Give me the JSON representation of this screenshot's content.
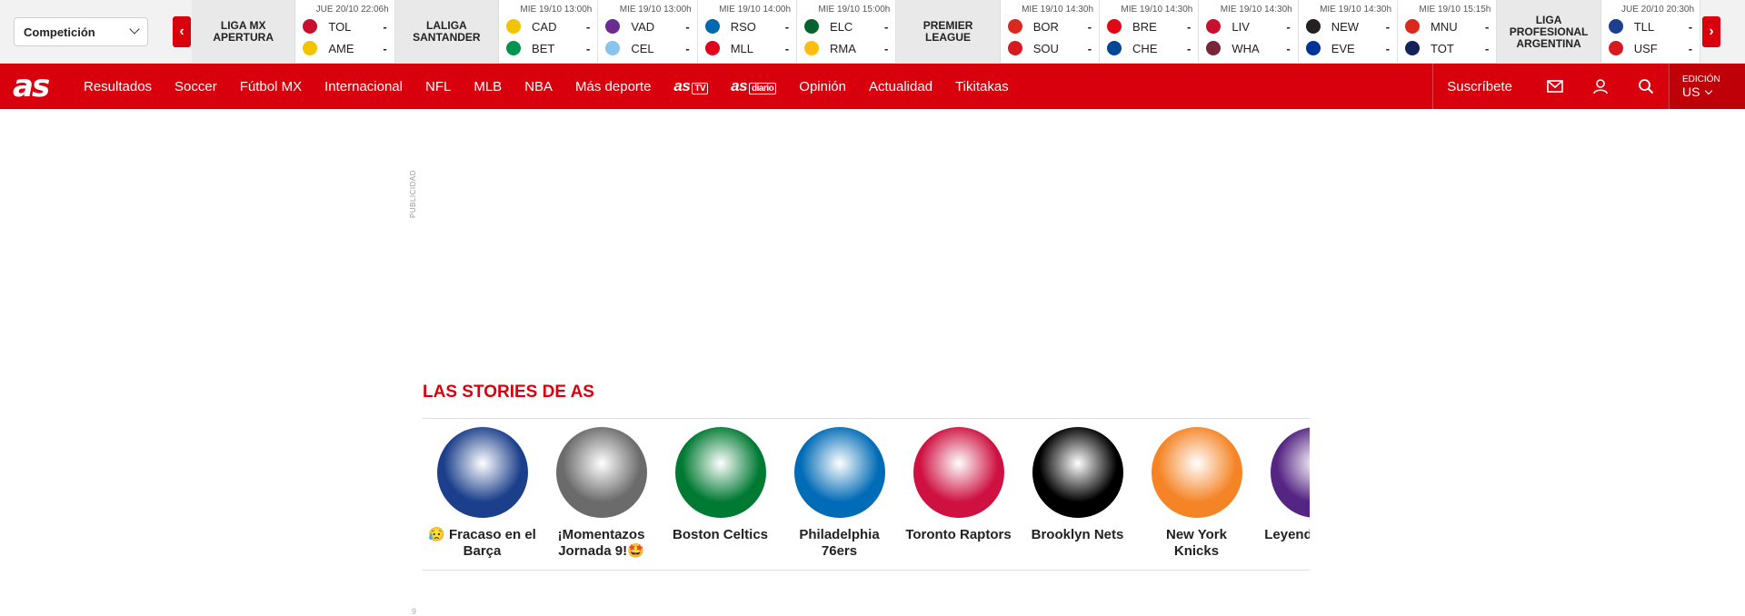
{
  "competition_select": {
    "value": "Competición"
  },
  "scoreboard": {
    "prev_label": "‹",
    "next_label": "›",
    "items": [
      {
        "kind": "league",
        "name": "LIGA MX APERTURA"
      },
      {
        "kind": "match",
        "date": "JUE 20/10 22:06h",
        "home": "TOL",
        "away": "AME",
        "home_score": "-",
        "away_score": "-",
        "home_color": "#c8102e",
        "away_color": "#f2c400"
      },
      {
        "kind": "league",
        "name": "LALIGA SANTANDER"
      },
      {
        "kind": "match",
        "date": "MIE 19/10 13:00h",
        "home": "CAD",
        "away": "BET",
        "home_score": "-",
        "away_score": "-",
        "home_color": "#f2c400",
        "away_color": "#00954c"
      },
      {
        "kind": "match",
        "date": "MIE 19/10 13:00h",
        "home": "VAD",
        "away": "CEL",
        "home_score": "-",
        "away_score": "-",
        "home_color": "#6b2c91",
        "away_color": "#8ac3ee"
      },
      {
        "kind": "match",
        "date": "MIE 19/10 14:00h",
        "home": "RSO",
        "away": "MLL",
        "home_score": "-",
        "away_score": "-",
        "home_color": "#0067b1",
        "away_color": "#e2001a"
      },
      {
        "kind": "match",
        "date": "MIE 19/10 15:00h",
        "home": "ELC",
        "away": "RMA",
        "home_score": "-",
        "away_score": "-",
        "home_color": "#05642c",
        "away_color": "#febe10"
      },
      {
        "kind": "league",
        "name": "PREMIER LEAGUE"
      },
      {
        "kind": "match",
        "date": "MIE 19/10 14:30h",
        "home": "BOR",
        "away": "SOU",
        "home_score": "-",
        "away_score": "-",
        "home_color": "#da291c",
        "away_color": "#d71920"
      },
      {
        "kind": "match",
        "date": "MIE 19/10 14:30h",
        "home": "BRE",
        "away": "CHE",
        "home_score": "-",
        "away_score": "-",
        "home_color": "#e30613",
        "away_color": "#034694"
      },
      {
        "kind": "match",
        "date": "MIE 19/10 14:30h",
        "home": "LIV",
        "away": "WHA",
        "home_score": "-",
        "away_score": "-",
        "home_color": "#c8102e",
        "away_color": "#7a263a"
      },
      {
        "kind": "match",
        "date": "MIE 19/10 14:30h",
        "home": "NEW",
        "away": "EVE",
        "home_score": "-",
        "away_score": "-",
        "home_color": "#241f20",
        "away_color": "#003399"
      },
      {
        "kind": "match",
        "date": "MIE 19/10 15:15h",
        "home": "MNU",
        "away": "TOT",
        "home_score": "-",
        "away_score": "-",
        "home_color": "#da291c",
        "away_color": "#132257"
      },
      {
        "kind": "league",
        "name": "LIGA PROFESIONAL ARGENTINA"
      },
      {
        "kind": "match",
        "date": "JUE 20/10 20:30h",
        "home": "TLL",
        "away": "USF",
        "home_score": "-",
        "away_score": "-",
        "home_color": "#1d3f8f",
        "away_color": "#d71920"
      }
    ]
  },
  "nav": {
    "logo": "as",
    "links": [
      "Resultados",
      "Soccer",
      "Fútbol MX",
      "Internacional",
      "NFL",
      "MLB",
      "NBA",
      "Más deporte"
    ],
    "astv": "as",
    "astv_tag": "TV",
    "asdiario": "as",
    "asdiario_tag": "diario",
    "links2": [
      "Opinión",
      "Actualidad",
      "Tikitakas"
    ],
    "subscribe": "Suscríbete",
    "edition_label": "EDICIÓN",
    "edition_value": "US"
  },
  "ad_label": "PUBLICIDAD",
  "stories": {
    "title": "LAS STORIES DE AS",
    "items": [
      {
        "label": "😥 Fracaso en el Barça",
        "color": "#1b3f8b"
      },
      {
        "label": "¡Momentazos Jornada 9!🤩",
        "color": "#6b6b6b"
      },
      {
        "label": "Boston Celtics",
        "color": "#007a33"
      },
      {
        "label": "Philadelphia 76ers",
        "color": "#006bb6"
      },
      {
        "label": "Toronto Raptors",
        "color": "#ce1141"
      },
      {
        "label": "Brooklyn Nets",
        "color": "#000000"
      },
      {
        "label": "New York Knicks",
        "color": "#f58426"
      },
      {
        "label": "Leyenda mate a L",
        "color": "#552583"
      }
    ]
  },
  "footer_mark": "9"
}
